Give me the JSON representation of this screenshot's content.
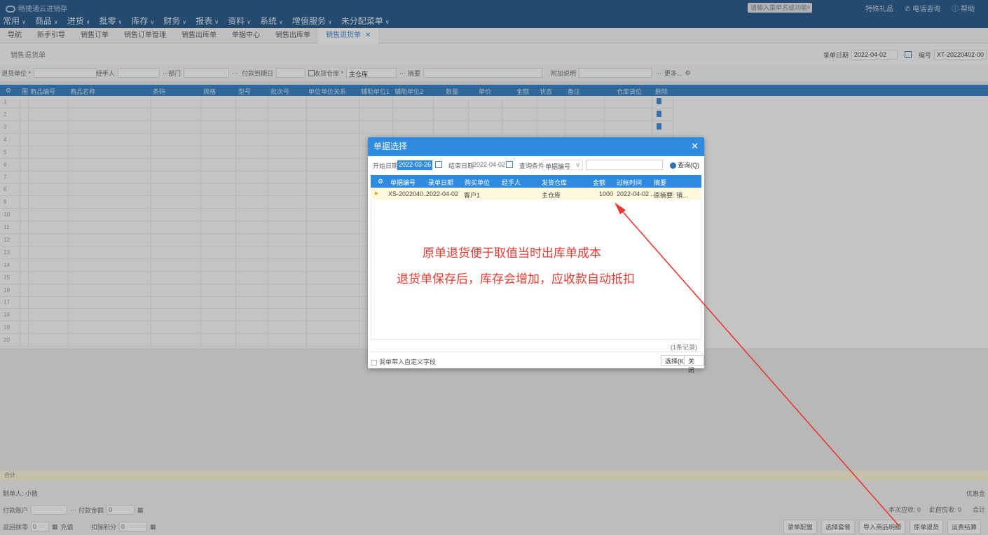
{
  "topbar": {
    "brand": "畅捷通云进销存",
    "menu": [
      {
        "label": "常用"
      },
      {
        "label": "商品"
      },
      {
        "label": "进货"
      },
      {
        "label": "批零"
      },
      {
        "label": "库存"
      },
      {
        "label": "财务"
      },
      {
        "label": "报表"
      },
      {
        "label": "资料"
      },
      {
        "label": "系统"
      },
      {
        "label": "增值服务"
      },
      {
        "label": "未分配菜单"
      }
    ],
    "search_placeholder": "请输入菜单名或功能",
    "links": [
      "特殊礼品",
      "电话咨询",
      "帮助"
    ]
  },
  "tabs": [
    {
      "label": "导航"
    },
    {
      "label": "新手引导"
    },
    {
      "label": "销售订单"
    },
    {
      "label": "销售订单管理"
    },
    {
      "label": "销售出库单"
    },
    {
      "label": "单据中心"
    },
    {
      "label": "销售出库单"
    },
    {
      "label": "销售退货单",
      "active": true
    }
  ],
  "doc": {
    "title": "销售退货单",
    "date_label": "录单日期",
    "date_value": "2022-04-02",
    "no_label": "编号",
    "no_value": "XT-20220402-00"
  },
  "filters": {
    "unit": "退货单位 *",
    "handler": "经手人",
    "dept": "部门",
    "due_date": "付款到期日",
    "warehouse": "收货仓库 *",
    "warehouse_value": "主仓库",
    "summary": "摘要",
    "note": "附加说明",
    "more": "更多..."
  },
  "grid": {
    "columns": [
      "图",
      "商品编号",
      "商品名称",
      "条码",
      "规格",
      "型号",
      "批次号",
      "单位",
      "单位关系",
      "辅助单位1",
      "辅助单位2",
      "数量",
      "单价",
      "金额",
      "状态",
      "备注",
      "仓库货位",
      "删除"
    ],
    "row_numbers": [
      "1",
      "2",
      "3",
      "4",
      "5",
      "6",
      "7",
      "8",
      "9",
      "10",
      "11",
      "12",
      "13",
      "14",
      "15",
      "16",
      "17",
      "18",
      "19",
      "20"
    ]
  },
  "footer": {
    "sum_label": "合计",
    "creator": "制单人: 小散",
    "discount": "优惠金",
    "pay_account": "付款账户",
    "pay_amount": "付款金额",
    "pay_amount_value": "0",
    "coupon": "返回抹零",
    "coupon_value": "0",
    "recharge": "充值",
    "points": "扣除积分",
    "points_value": "0",
    "receivable_now": "本次应收: 0",
    "receivable_total": "此前应收: 0",
    "total": "合计",
    "buttons": [
      "录单配置",
      "选择套餐",
      "导入商品明细",
      "原单退货",
      "运费结算"
    ]
  },
  "dialog": {
    "title": "单据选择",
    "start_label": "开始日期",
    "start_value": "2022-03-26",
    "end_label": "结束日期",
    "end_value": "2022-04-02",
    "cond_label": "查询条件",
    "cond_value": "单据编号",
    "query_btn": "查询(Q)",
    "columns": [
      "单据编号",
      "录单日期",
      "购买单位",
      "经手人",
      "发货仓库",
      "金额",
      "过帐时间",
      "摘要"
    ],
    "rows": [
      {
        "no": "XS-2022040...",
        "date": "2022-04-02",
        "buyer": "客户1",
        "handler": "",
        "warehouse": "主仓库",
        "amount": "1000",
        "post_time": "2022-04-02 ...",
        "summary": "原摘要: 销..."
      }
    ],
    "count": "(1条记录)",
    "custom_field": "调单带入自定义字段",
    "select_btn": "选择(K)",
    "close_btn": "关闭"
  },
  "annotations": {
    "line1": "原单退货便于取值当时出库单成本",
    "line2": "退货单保存后，库存会增加，应收款自动抵扣",
    "color": "#e8392f"
  }
}
